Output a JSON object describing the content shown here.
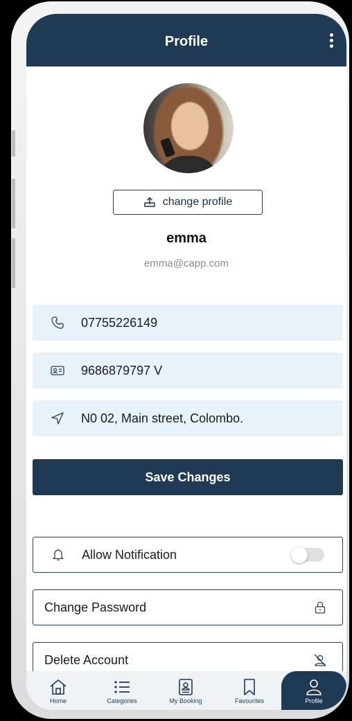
{
  "header": {
    "title": "Profile"
  },
  "profile": {
    "change_label": "change profile",
    "name": "emma",
    "email": "emma@capp.com"
  },
  "info": {
    "phone": "07755226149",
    "nic": "9686879797 V",
    "address": "N0 02, Main street, Colombo."
  },
  "save_label": "Save Changes",
  "options": {
    "notification_label": "Allow Notification",
    "notification_enabled": false,
    "change_password_label": "Change Password",
    "delete_account_label": "Delete Account"
  },
  "nav": {
    "home": "Home",
    "categories": "Categories",
    "booking": "My Booking",
    "favourites": "Favourites",
    "profile": "Profile",
    "active": "profile"
  },
  "colors": {
    "primary": "#1f3a52",
    "info_bg": "#e7f2fa",
    "nav_bg": "#eef2f5"
  }
}
